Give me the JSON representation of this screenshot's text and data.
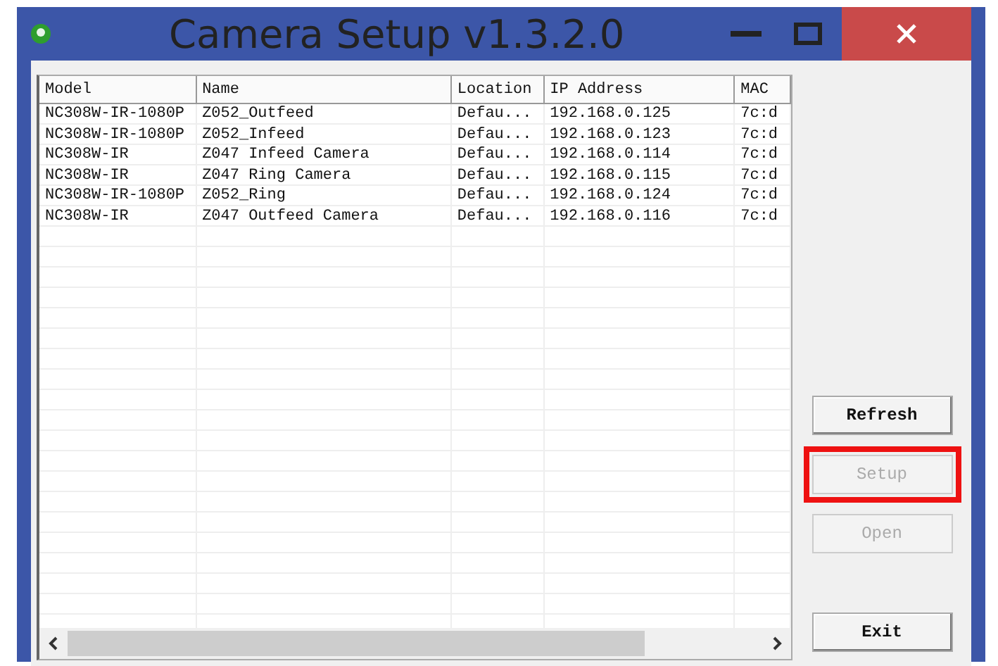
{
  "window": {
    "title": "Camera Setup v1.3.2.0"
  },
  "table": {
    "columns": [
      "Model",
      "Name",
      "Location",
      "IP Address",
      "MAC"
    ],
    "rows": [
      [
        "NC308W-IR-1080P",
        "Z052_Outfeed",
        "Defau...",
        "192.168.0.125",
        "7c:d"
      ],
      [
        "NC308W-IR-1080P",
        "Z052_Infeed",
        "Defau...",
        "192.168.0.123",
        "7c:d"
      ],
      [
        "NC308W-IR",
        "Z047 Infeed Camera",
        "Defau...",
        "192.168.0.114",
        "7c:d"
      ],
      [
        "NC308W-IR",
        "Z047 Ring Camera",
        "Defau...",
        "192.168.0.115",
        "7c:d"
      ],
      [
        "NC308W-IR-1080P",
        "Z052_Ring",
        "Defau...",
        "192.168.0.124",
        "7c:d"
      ],
      [
        "NC308W-IR",
        "Z047 Outfeed Camera",
        "Defau...",
        "192.168.0.116",
        "7c:d"
      ]
    ]
  },
  "buttons": [
    {
      "label": "Refresh",
      "disabled": false,
      "highlighted": false
    },
    {
      "label": "Setup",
      "disabled": true,
      "highlighted": true
    },
    {
      "label": "Open",
      "disabled": true,
      "highlighted": false
    },
    {
      "label": "Exit",
      "disabled": false,
      "highlighted": false
    }
  ]
}
